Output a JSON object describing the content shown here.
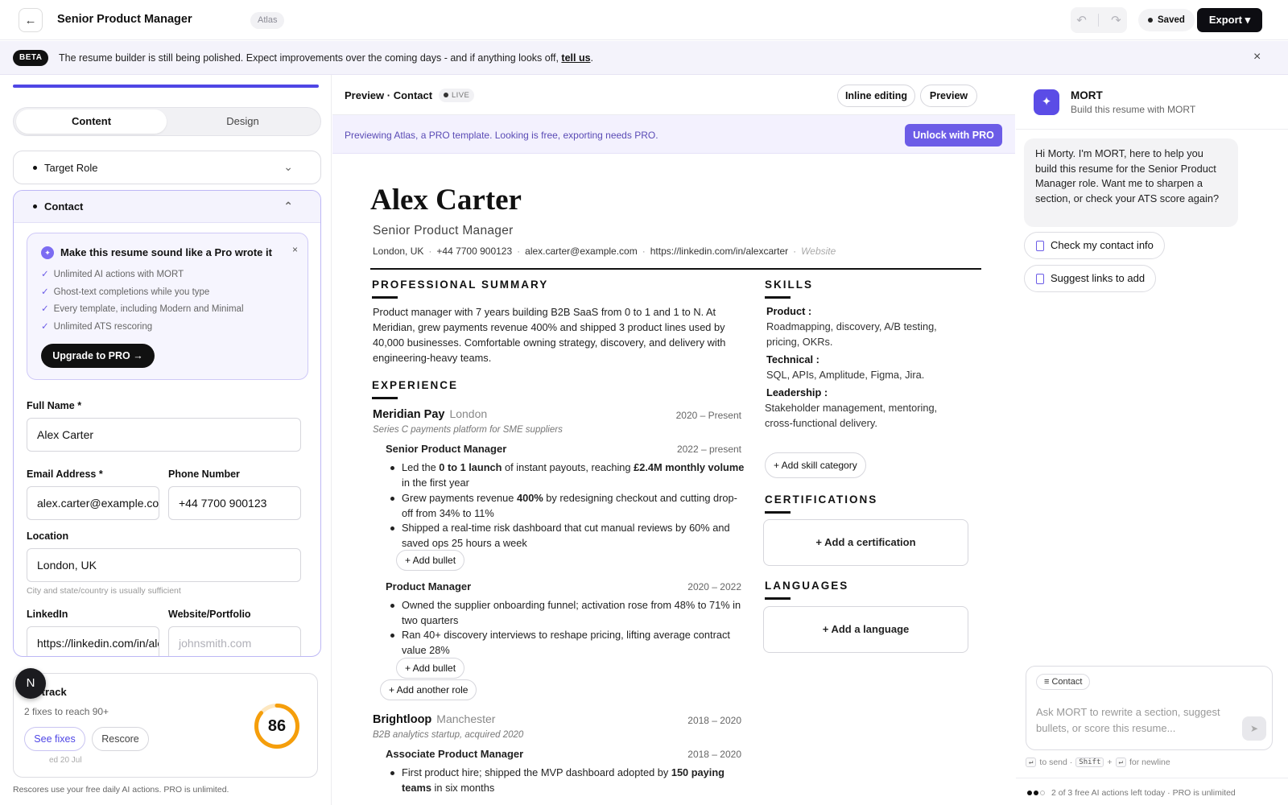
{
  "topbar": {
    "back_icon": "←",
    "doc_title": "Senior Product Manager",
    "template_chip": "Atlas",
    "undo_icon": "↶",
    "redo_icon": "↷",
    "saved_label": "Saved",
    "export_label": "Export ▾"
  },
  "beta": {
    "badge": "BETA",
    "text": "The resume builder is still being polished. Expect improvements over the coming days - and if anything looks off,",
    "link": "tell us",
    "period": ".",
    "close_icon": "×"
  },
  "left": {
    "tabs": {
      "content": "Content",
      "design": "Design"
    },
    "target_role": {
      "label": "Target Role",
      "chevron": "⌄"
    },
    "contact": {
      "label": "Contact",
      "chevron": "⌃"
    },
    "pro_card": {
      "spark_icon": "✦",
      "title": "Make this resume sound like a Pro wrote it",
      "close_icon": "×",
      "check": "✓",
      "items": [
        "Unlimited AI actions with MORT",
        "Ghost-text completions while you type",
        "Every template, including Modern and Minimal",
        "Unlimited ATS rescoring"
      ],
      "cta": "Upgrade to PRO →"
    },
    "fields": {
      "full_name": {
        "label": "Full Name *",
        "value": "Alex Carter"
      },
      "email": {
        "label": "Email Address *",
        "value": "alex.carter@example.com"
      },
      "phone": {
        "label": "Phone Number",
        "value": "+44 7700 900123"
      },
      "location": {
        "label": "Location",
        "value": "London, UK",
        "hint": "City and state/country is usually sufficient"
      },
      "linkedin": {
        "label": "LinkedIn",
        "value": "https://linkedin.com/in/alexcarter"
      },
      "website": {
        "label": "Website/Portfolio",
        "placeholder": "johnsmith.com"
      }
    },
    "score": {
      "title": "On track",
      "subtitle": "2 fixes to reach 90+",
      "see_fixes": "See fixes",
      "rescore": "Rescore",
      "date": "ed 20 Jul",
      "value": 86,
      "ring_color": "#f59e0b",
      "footer": "Rescores use your free daily AI actions. PRO is unlimited."
    },
    "avatar_letter": "N"
  },
  "middle": {
    "header_title": "Preview · Contact",
    "live": "LIVE",
    "inline_editing": "Inline editing",
    "preview": "Preview",
    "banner_text": "Previewing Atlas, a PRO template. Looking is free, exporting needs PRO.",
    "unlock": "Unlock with PRO"
  },
  "resume": {
    "name": "Alex Carter",
    "role": "Senior Product Manager",
    "contact": {
      "location": "London, UK",
      "phone": "+44 7700 900123",
      "email": "alex.carter@example.com",
      "linkedin": "https://linkedin.com/in/alexcarter",
      "website": "Website",
      "sep": "·"
    },
    "summary_heading": "PROFESSIONAL SUMMARY",
    "summary": "Product manager with 7 years building B2B SaaS from 0 to 1 and 1 to N. At Meridian, grew payments revenue 400% and shipped 3 product lines used by 40,000 businesses. Comfortable owning strategy, discovery, and delivery with engineering-heavy teams.",
    "experience_heading": "EXPERIENCE",
    "meridian": {
      "company": "Meridian Pay",
      "location": "London",
      "dates": "2020 – Present",
      "desc": "Series C payments platform for SME suppliers",
      "role1": {
        "title": "Senior Product Manager",
        "dates": "2022 – present",
        "b1": {
          "a": "Led the ",
          "b": "0 to 1 launch",
          "c": " of instant payouts, reaching ",
          "d": "£2.4M monthly volume",
          "e": " in the first year"
        },
        "b2": {
          "a": "Grew payments revenue ",
          "b": "400%",
          "c": " by redesigning checkout and cutting drop-off from 34% to 11%"
        },
        "b3": "Shipped a real-time risk dashboard that cut manual reviews by 60% and saved ops 25 hours a week"
      },
      "role2": {
        "title": "Product Manager",
        "dates": "2020 – 2022",
        "b1": "Owned the supplier onboarding funnel; activation rose from 48% to 71% in two quarters",
        "b2": "Ran 40+ discovery interviews to reshape pricing, lifting average contract value 28%"
      },
      "add_bullet": "+ Add bullet",
      "add_role": "+ Add another role"
    },
    "brightloop": {
      "company": "Brightloop",
      "location": "Manchester",
      "dates": "2018 – 2020",
      "desc": "B2B analytics startup, acquired 2020",
      "role1": {
        "title": "Associate Product Manager",
        "dates": "2018 – 2020",
        "b1": {
          "a": "First product hire; shipped the MVP dashboard adopted by ",
          "b": "150 paying teams",
          "c": " in six months"
        }
      }
    },
    "skills_heading": "SKILLS",
    "skills": [
      {
        "head": "Product :",
        "text": "Roadmapping, discovery, A/B testing, pricing, OKRs."
      },
      {
        "head": "Technical :",
        "text": "SQL, APIs, Amplitude, Figma, Jira."
      },
      {
        "head": "Leadership :",
        "text": "Stakeholder management, mentoring, cross-functional delivery."
      }
    ],
    "add_skill": "+ Add skill category",
    "cert_heading": "CERTIFICATIONS",
    "add_cert": "+ Add a certification",
    "lang_heading": "LANGUAGES",
    "add_lang": "+ Add a language"
  },
  "right": {
    "mort_icon": "✦",
    "mort_name": "MORT",
    "mort_sub": "Build this resume with MORT",
    "greeting": "Hi Morty. I'm MORT, here to help you build this resume for the Senior Product Manager role. Want me to sharpen a section, or check your ATS score again?",
    "suggestions": [
      "Check my contact info",
      "Suggest links to add"
    ],
    "context_chip": "≡ Contact",
    "composer_placeholder": "Ask MORT to rewrite a section, suggest bullets, or score this resume...",
    "send_icon": "➤",
    "hint": {
      "enter": "↵",
      "to_send": "to send ·",
      "shift": "Shift",
      "plus": "+",
      "newline": "for newline"
    },
    "footer": "2 of 3 free AI actions left today · PRO is unlimited"
  }
}
